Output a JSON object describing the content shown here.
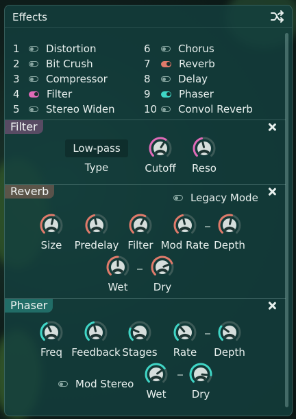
{
  "panel": {
    "title": "Effects"
  },
  "effects": [
    {
      "num": "1",
      "name": "Distortion",
      "on": false
    },
    {
      "num": "2",
      "name": "Bit Crush",
      "on": false
    },
    {
      "num": "3",
      "name": "Compressor",
      "on": false
    },
    {
      "num": "4",
      "name": "Filter",
      "on": true,
      "color": "#e06ab8"
    },
    {
      "num": "5",
      "name": "Stereo Widen",
      "on": false
    },
    {
      "num": "6",
      "name": "Chorus",
      "on": false
    },
    {
      "num": "7",
      "name": "Reverb",
      "on": true,
      "color": "#e07a6a"
    },
    {
      "num": "8",
      "name": "Delay",
      "on": false
    },
    {
      "num": "9",
      "name": "Phaser",
      "on": true,
      "color": "#3fd6c6"
    },
    {
      "num": "10",
      "name": "Convol Reverb",
      "on": false
    }
  ],
  "filter": {
    "title": "Filter",
    "color": "#e06ab8",
    "type_value": "Low-pass",
    "type_label": "Type",
    "knobs": [
      {
        "label": "Cutoff",
        "value": 0.62
      },
      {
        "label": "Reso",
        "value": 0.45
      }
    ]
  },
  "reverb": {
    "title": "Reverb",
    "color": "#e07a6a",
    "legacy_label": "Legacy Mode",
    "knobs": [
      {
        "label": "Size",
        "value": 0.55
      },
      {
        "label": "Predelay",
        "value": 0.45
      },
      {
        "label": "Filter",
        "value": 0.6
      },
      {
        "label": "Mod Rate",
        "value": 0.45
      },
      {
        "label": "Depth",
        "value": 0.55
      },
      {
        "label": "Wet",
        "value": 0.5
      },
      {
        "label": "Dry",
        "value": 0.75
      }
    ]
  },
  "phaser": {
    "title": "Phaser",
    "color": "#3fd6c6",
    "mod_stereo_label": "Mod Stereo",
    "knobs": [
      {
        "label": "Freq",
        "value": 0.4
      },
      {
        "label": "Feedback",
        "value": 0.45
      },
      {
        "label": "Stages",
        "value": 0.25
      },
      {
        "label": "Rate",
        "value": 0.35
      },
      {
        "label": "Depth",
        "value": 0.3
      },
      {
        "label": "Wet",
        "value": 0.7
      },
      {
        "label": "Dry",
        "value": 0.85
      }
    ]
  }
}
